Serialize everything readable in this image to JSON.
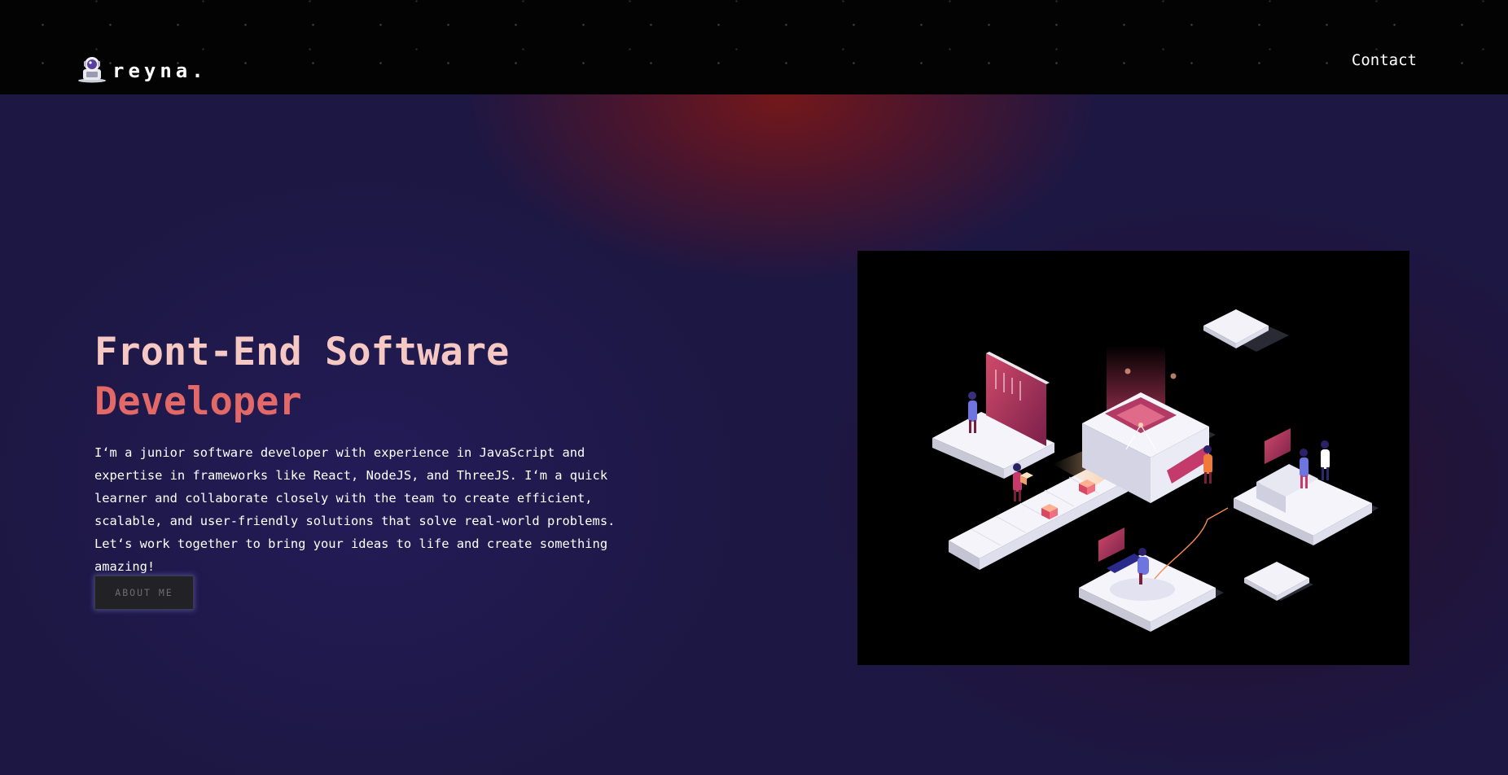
{
  "brand": {
    "name": "reyna.",
    "logo_icon": "robot-astronaut-icon"
  },
  "nav": {
    "contact_label": "Contact"
  },
  "hero": {
    "title_line1": "Front-End Software",
    "title_line2": "Developer",
    "description": "I‘m a junior software developer with experience in JavaScript and expertise in frameworks like React, NodeJS, and ThreeJS. I‘m a quick learner and collaborate closely with the team to create efficient, scalable, and user-friendly solutions that solve real-world problems. Let‘s work together to bring your ideas to life and create something amazing!",
    "button_label": "ABOUT ME",
    "illustration_icon": "isometric-workspace-illustration"
  },
  "colors": {
    "title_light": "#f6c8c4",
    "title_accent": "#e36969",
    "background": "#1d1743",
    "navbar": "#030303"
  }
}
